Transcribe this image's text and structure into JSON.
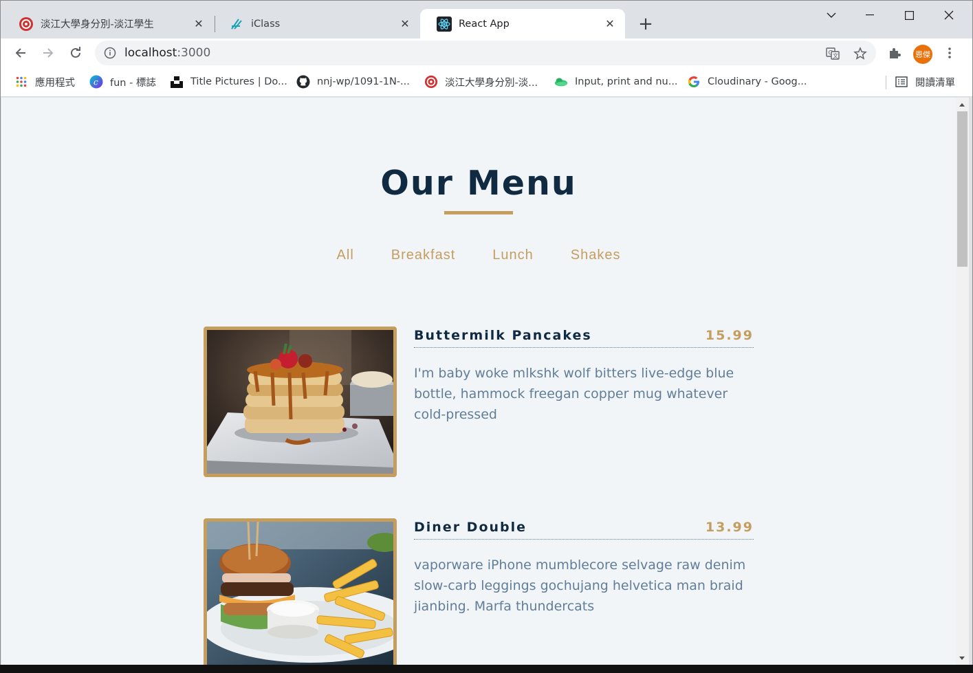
{
  "browser": {
    "tabs": [
      {
        "title": "淡江大學身分別-淡江學生",
        "icon": "tku-logo-icon"
      },
      {
        "title": "iClass",
        "icon": "iclass-icon"
      },
      {
        "title": "React App",
        "icon": "react-icon",
        "active": true
      }
    ],
    "url_host": "localhost",
    "url_port": ":3000",
    "profile_initials": "恩傑",
    "bookmarks": [
      {
        "label": "應用程式",
        "icon": "apps-grid-icon"
      },
      {
        "label": "fun - 標誌",
        "icon": "canva-icon"
      },
      {
        "label": "Title Pictures | Do...",
        "icon": "unsplash-icon"
      },
      {
        "label": "nnj-wp/1091-1N-...",
        "icon": "github-icon"
      },
      {
        "label": "淡江大學身分別-淡...",
        "icon": "tku-logo-icon"
      },
      {
        "label": "Input, print and nu...",
        "icon": "cloud-icon"
      },
      {
        "label": "Cloudinary - Goog...",
        "icon": "google-icon"
      }
    ],
    "reading_list": "閱讀清單"
  },
  "page": {
    "title": "Our Menu",
    "categories": [
      "All",
      "Breakfast",
      "Lunch",
      "Shakes"
    ],
    "items": [
      {
        "name": "Buttermilk Pancakes",
        "price": "15.99",
        "description": "I'm baby woke mlkshk wolf bitters live-edge blue bottle, hammock freegan copper mug whatever cold-pressed"
      },
      {
        "name": "Diner Double",
        "price": "13.99",
        "description": "vaporware iPhone mumblecore selvage raw denim slow-carb leggings gochujang helvetica man braid jianbing. Marfa thundercats"
      }
    ]
  },
  "colors": {
    "primary": "#c59d5f",
    "heading": "#102a42",
    "text": "#617d98",
    "background": "#f1f5f8"
  }
}
